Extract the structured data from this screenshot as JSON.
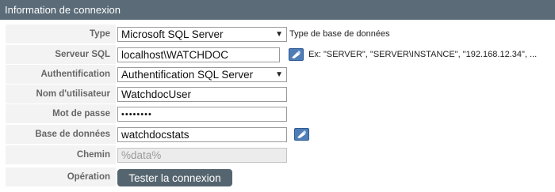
{
  "panel": {
    "title": "Information de connexion"
  },
  "fields": {
    "type": {
      "label": "Type",
      "value": "Microsoft SQL Server",
      "hint": "Type de base de données"
    },
    "server": {
      "label": "Serveur SQL",
      "value": "localhost\\WATCHDOC",
      "hint": "Ex: \"SERVER\", \"SERVER\\INSTANCE\", \"192.168.12.34\", ..."
    },
    "auth": {
      "label": "Authentification",
      "value": "Authentification SQL Server"
    },
    "username": {
      "label": "Nom d'utilisateur",
      "value": "WatchdocUser"
    },
    "password": {
      "label": "Mot de passe",
      "value": "••••••••"
    },
    "database": {
      "label": "Base de données",
      "value": "watchdocstats"
    },
    "path": {
      "label": "Chemin",
      "value": "%data%"
    },
    "operation": {
      "label": "Opération",
      "button": "Tester la connexion"
    }
  },
  "icons": {
    "help": "browse-icon",
    "dropdown": "chevron-down-icon"
  },
  "colors": {
    "header": "#5b6b78",
    "button": "#55656f",
    "help": "#4f7db8",
    "label": "#666666"
  }
}
